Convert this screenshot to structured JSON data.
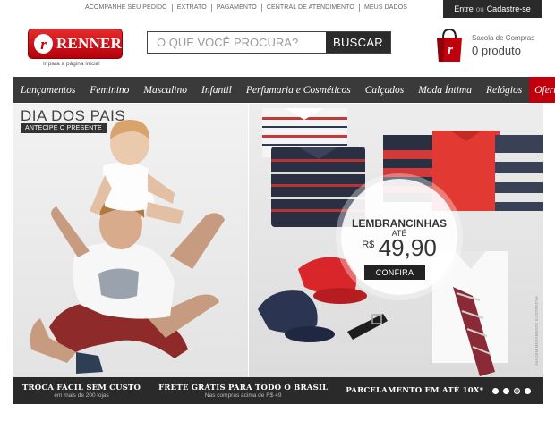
{
  "top_links": [
    "Acompanhe seu pedido",
    "Extrato",
    "Pagamento",
    "Central de Atendimento",
    "Meus dados"
  ],
  "login": {
    "enter": "Entre",
    "or": "ou",
    "register": "Cadastre-se"
  },
  "logo": {
    "text": "RENNER",
    "badge_letter": "r",
    "subtitle": "Ir para a página inicial"
  },
  "search": {
    "placeholder": "O QUE VOCÊ PROCURA?",
    "button": "BUSCAR"
  },
  "cart": {
    "label": "Sacola de Compras",
    "count": "0 produto"
  },
  "nav": {
    "items": [
      "Lançamentos",
      "Feminino",
      "Masculino",
      "Infantil",
      "Perfumaria e Cosméticos",
      "Calçados",
      "Moda Íntima",
      "Relógios"
    ],
    "active": "Ofertas"
  },
  "banner": {
    "left": {
      "title": "DIA DOS PAIS",
      "subtitle": "ANTECIPE O PRESENTE"
    },
    "right": {
      "title": "LEMBRANCINHAS",
      "until": "ATÉ",
      "currency": "R$",
      "price": "49,90",
      "button": "CONFIRA",
      "disclaimer": "IMAGEM MERAMENTE ILUSTRATIVA"
    }
  },
  "benefits": [
    {
      "title": "TROCA FÁCIL SEM CUSTO",
      "sub": "em mais de 200 lojas"
    },
    {
      "title": "FRETE GRÁTIS PARA TODO O BRASIL",
      "sub": "Nas compras acima de R$ 49"
    },
    {
      "title": "PARCELAMENTO EM ATÉ 10X*",
      "sub": ""
    }
  ],
  "carousel": {
    "total": 4,
    "active_index": 2
  },
  "colors": {
    "brand_red": "#c0000c",
    "nav_bg": "#3a3a3a",
    "bar_bg": "#2a2a2a"
  }
}
